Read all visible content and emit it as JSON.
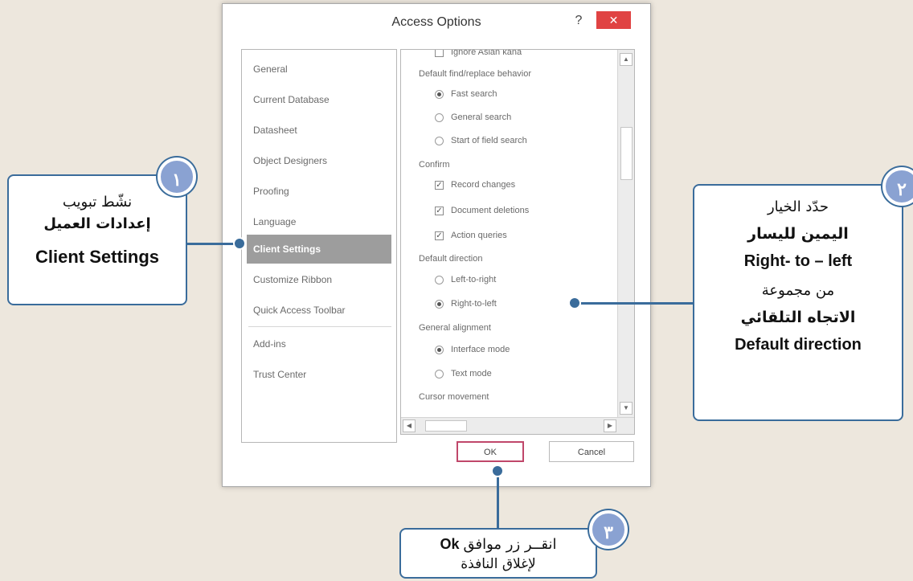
{
  "dialog": {
    "title": "Access Options",
    "help": "?",
    "close": "✕",
    "nav": [
      "General",
      "Current Database",
      "Datasheet",
      "Object Designers",
      "Proofing",
      "Language",
      "Client Settings",
      "Customize Ribbon",
      "Quick Access Toolbar",
      "Add-ins",
      "Trust Center"
    ],
    "active_nav": "Client Settings",
    "options": {
      "cut_top": "Ignore Asian kana",
      "find_replace": {
        "heading": "Default find/replace behavior",
        "items": [
          "Fast search",
          "General search",
          "Start of field search"
        ],
        "selected": "Fast search"
      },
      "confirm": {
        "heading": "Confirm",
        "items": [
          "Record changes",
          "Document deletions",
          "Action queries"
        ]
      },
      "direction": {
        "heading": "Default direction",
        "items": [
          "Left-to-right",
          "Right-to-left"
        ],
        "selected": "Right-to-left"
      },
      "alignment": {
        "heading": "General alignment",
        "items": [
          "Interface mode",
          "Text mode"
        ],
        "selected": "Interface mode"
      },
      "cursor": {
        "heading": "Cursor movement"
      }
    },
    "buttons": {
      "ok": "OK",
      "cancel": "Cancel"
    }
  },
  "callouts": {
    "c1": {
      "badge": "١",
      "line1": "نشّط تبويب",
      "line2": "إعدادات العميل",
      "line3": "Client Settings"
    },
    "c2": {
      "badge": "٢",
      "line1": "حدّد الخيار",
      "line2": "اليمين لليسار",
      "line3": "Right- to – left",
      "line4": "من مجموعة",
      "line5": "الاتجاه التلقائي",
      "line6": "Default direction"
    },
    "c3": {
      "badge": "٣",
      "line1_ar": "انقــر زر موافق",
      "line1_en": "Ok",
      "line2": "لإغلاق النافذة"
    }
  },
  "colors": {
    "background": "#ede7dd",
    "callout_border": "#3a6c9b",
    "badge_fill": "#8aa2d2",
    "close_button": "#e04343",
    "ok_border": "#c0476a",
    "active_nav": "#9d9d9d"
  },
  "icons": {
    "radio_on": "radio-selected",
    "checkbox_on": "checkbox-checked",
    "scroll_up": "chevron-up-icon",
    "scroll_down": "chevron-down-icon",
    "scroll_left": "chevron-left-icon",
    "scroll_right": "chevron-right-icon"
  }
}
